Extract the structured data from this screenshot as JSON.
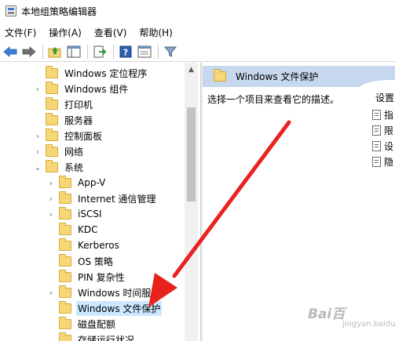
{
  "window": {
    "title": "本地组策略编辑器"
  },
  "menu": [
    "文件(F)",
    "操作(A)",
    "查看(V)",
    "帮助(H)"
  ],
  "toolbar": {
    "buttons": [
      "back-icon",
      "forward-icon",
      "up-folder-icon",
      "show-hide-tree-icon",
      "export-list-icon",
      "help-icon",
      "properties-icon",
      "filter-icon"
    ]
  },
  "tree": {
    "items": [
      {
        "label": "Windows 定位程序",
        "expander": ""
      },
      {
        "label": "Windows 组件",
        "expander": "›"
      },
      {
        "label": "打印机",
        "expander": ""
      },
      {
        "label": "服务器",
        "expander": ""
      },
      {
        "label": "控制面板",
        "expander": "›"
      },
      {
        "label": "网络",
        "expander": "›"
      },
      {
        "label": "系统",
        "expander": "⌄"
      },
      {
        "label": "App-V",
        "expander": "›"
      },
      {
        "label": "Internet 通信管理",
        "expander": "›"
      },
      {
        "label": "iSCSI",
        "expander": "›"
      },
      {
        "label": "KDC",
        "expander": ""
      },
      {
        "label": "Kerberos",
        "expander": ""
      },
      {
        "label": "OS 策略",
        "expander": ""
      },
      {
        "label": "PIN 复杂性",
        "expander": ""
      },
      {
        "label": "Windows 时间服务",
        "expander": "›"
      },
      {
        "label": "Windows 文件保护",
        "expander": ""
      },
      {
        "label": "磁盘配额",
        "expander": ""
      },
      {
        "label": "存储运行状况",
        "expander": ""
      }
    ],
    "selected_label": "Windows 文件保护"
  },
  "right_pane": {
    "header_title": "Windows 文件保护",
    "description": "选择一个项目来查看它的描述。",
    "settings_header": "设置",
    "settings": [
      "指",
      "限",
      "设",
      "隐"
    ]
  },
  "watermark": {
    "brand": "Bai百",
    "sub": "jingyan.baidu.com"
  },
  "colors": {
    "header_bg": "#c6d8ee",
    "selection_bg": "#cce8ff",
    "arrow": "#e8231e",
    "folder": "#f7d676"
  }
}
